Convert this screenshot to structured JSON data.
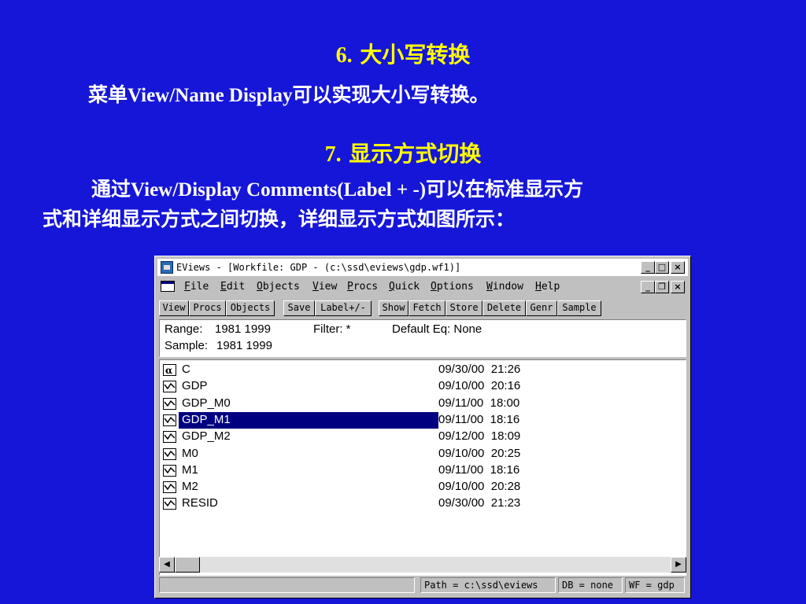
{
  "slide": {
    "heading1": {
      "num": "6.",
      "text": "大小写转换"
    },
    "para1": {
      "pre": "菜单",
      "mid": "View/Name Display",
      "post": "可以实现大小写转换。"
    },
    "heading2": {
      "num": "7.",
      "text": "显示方式切换"
    },
    "para2": {
      "line1_pre": "通过",
      "line1_mid": "View/Display Comments(Label + -)",
      "line1_post": "可以在标准显示方",
      "line2": "式和详细显示方式之间切换，详细显示方式如图所示："
    }
  },
  "window": {
    "title": "EViews - [Workfile: GDP - (c:\\ssd\\eviews\\gdp.wf1)]",
    "title_buttons": [
      "_",
      "□",
      "×"
    ],
    "doc_buttons": [
      "_",
      "❐",
      "×"
    ],
    "menu": [
      {
        "u": "F",
        "rest": "ile"
      },
      {
        "u": "E",
        "rest": "dit"
      },
      {
        "u": "O",
        "rest": "bjects"
      },
      {
        "u": "V",
        "rest": "iew"
      },
      {
        "u": "P",
        "rest": "rocs"
      },
      {
        "u": "Q",
        "rest": "uick"
      },
      {
        "u": "O",
        "rest": "ptions"
      },
      {
        "u": "W",
        "rest": "indow"
      },
      {
        "u": "H",
        "rest": "elp"
      }
    ],
    "toolbar": [
      "View",
      "Procs",
      "Objects",
      "Save",
      "Label+/-",
      "Show",
      "Fetch",
      "Store",
      "Delete",
      "Genr",
      "Sample"
    ],
    "info": {
      "range_label": "Range:",
      "range_value": "1981 1999",
      "filter": "Filter: *",
      "default_eq": "Default Eq: None",
      "sample_label": "Sample:",
      "sample_value": "1981 1999"
    },
    "objects": [
      {
        "name": "C",
        "date": "09/30/00",
        "time": "21:26",
        "icon": "coef-icon",
        "selected": false
      },
      {
        "name": "GDP",
        "date": "09/10/00",
        "time": "20:16",
        "icon": "series-icon",
        "selected": false
      },
      {
        "name": "GDP_M0",
        "date": "09/11/00",
        "time": "18:00",
        "icon": "series-icon",
        "selected": false
      },
      {
        "name": "GDP_M1",
        "date": "09/11/00",
        "time": "18:16",
        "icon": "series-icon",
        "selected": true
      },
      {
        "name": "GDP_M2",
        "date": "09/12/00",
        "time": "18:09",
        "icon": "series-icon",
        "selected": false
      },
      {
        "name": "M0",
        "date": "09/10/00",
        "time": "20:25",
        "icon": "series-icon",
        "selected": false
      },
      {
        "name": "M1",
        "date": "09/11/00",
        "time": "18:16",
        "icon": "series-icon",
        "selected": false
      },
      {
        "name": "M2",
        "date": "09/10/00",
        "time": "20:28",
        "icon": "series-icon",
        "selected": false
      },
      {
        "name": "RESID",
        "date": "09/30/00",
        "time": "21:23",
        "icon": "series-icon",
        "selected": false
      }
    ],
    "status": {
      "path": "Path = c:\\ssd\\eviews",
      "db": "DB = none",
      "wf": "WF = gdp"
    }
  },
  "colors": {
    "background": "#1616d8",
    "heading": "#ffff00",
    "text": "#ffffff",
    "selection": "#000080"
  }
}
